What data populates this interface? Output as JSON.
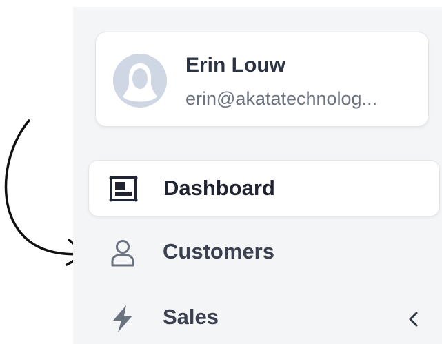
{
  "user": {
    "name": "Erin Louw",
    "email": "erin@akatatechnolog..."
  },
  "nav": {
    "items": [
      {
        "label": "Dashboard",
        "icon": "dashboard-icon",
        "active": true
      },
      {
        "label": "Customers",
        "icon": "user-icon",
        "active": false
      },
      {
        "label": "Sales",
        "icon": "lightning-icon",
        "active": false,
        "expandable": true
      }
    ]
  },
  "colors": {
    "sidebar_bg": "#f4f5f7",
    "card_bg": "#ffffff",
    "text_primary": "#2c3444",
    "text_secondary": "#6b7280",
    "avatar_bg": "#cfd6e4"
  }
}
